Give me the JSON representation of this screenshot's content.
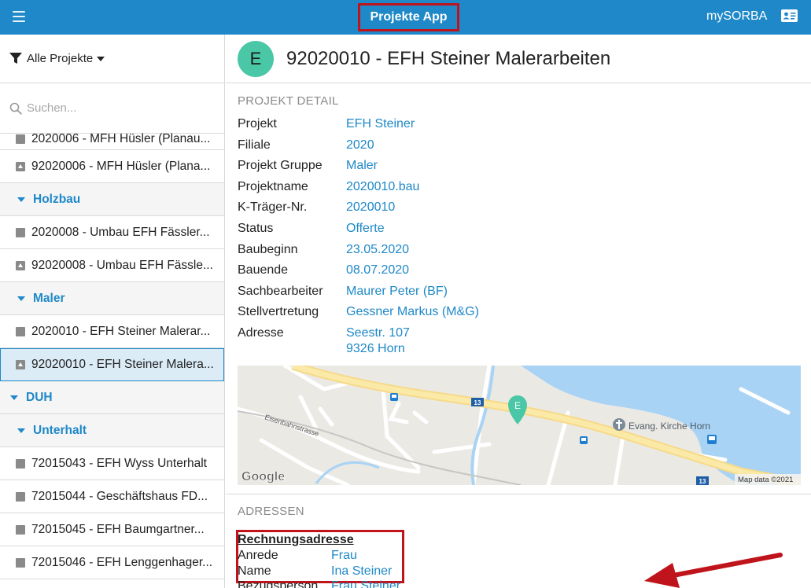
{
  "topbar": {
    "title": "Projekte App",
    "user_link": "mySORBA",
    "menu_icon": "hamburger-icon",
    "profile_icon": "id-card-icon",
    "color": "#1e88c8"
  },
  "sidebar": {
    "filter_label": "Alle Projekte",
    "search_placeholder": "Suchen...",
    "items": [
      {
        "type": "item",
        "icon": "square",
        "label": "2020006 - MFH Hüsler (Planau..."
      },
      {
        "type": "item",
        "icon": "square-tri",
        "label": "92020006 - MFH Hüsler (Plana..."
      },
      {
        "type": "group",
        "level": 1,
        "label": "Holzbau"
      },
      {
        "type": "item",
        "icon": "square",
        "label": "2020008 - Umbau EFH Fässler..."
      },
      {
        "type": "item",
        "icon": "square-tri",
        "label": "92020008 - Umbau EFH Fässle..."
      },
      {
        "type": "group",
        "level": 1,
        "label": "Maler"
      },
      {
        "type": "item",
        "icon": "square",
        "label": "2020010 - EFH Steiner Malerar..."
      },
      {
        "type": "item",
        "icon": "square-tri",
        "label": "92020010 - EFH Steiner Malera...",
        "selected": true
      },
      {
        "type": "group",
        "level": 0,
        "label": "DUH"
      },
      {
        "type": "group",
        "level": 1,
        "label": "Unterhalt"
      },
      {
        "type": "item",
        "icon": "square",
        "label": "72015043 - EFH Wyss Unterhalt"
      },
      {
        "type": "item",
        "icon": "square",
        "label": "72015044 - Geschäftshaus FD..."
      },
      {
        "type": "item",
        "icon": "square",
        "label": "72015045 - EFH Baumgartner..."
      },
      {
        "type": "item",
        "icon": "square",
        "label": "72015046 - EFH Lenggenhager..."
      }
    ]
  },
  "detail": {
    "avatar_letter": "E",
    "title": "92020010 - EFH Steiner Malerarbeiten",
    "section_title": "PROJEKT DETAIL",
    "fields": [
      {
        "label": "Projekt",
        "value": "EFH Steiner"
      },
      {
        "label": "Filiale",
        "value": "2020"
      },
      {
        "label": "Projekt Gruppe",
        "value": "Maler"
      },
      {
        "label": "Projektname",
        "value": "2020010.bau"
      },
      {
        "label": "K-Träger-Nr.",
        "value": "2020010"
      },
      {
        "label": "Status",
        "value": "Offerte"
      },
      {
        "label": "Baubeginn",
        "value": "23.05.2020"
      },
      {
        "label": "Bauende",
        "value": "08.07.2020"
      },
      {
        "label": "Sachbearbeiter",
        "value": "Maurer Peter (BF)"
      },
      {
        "label": "Stellvertretung",
        "value": "Gessner Markus (M&G)"
      },
      {
        "label": "Adresse",
        "value": "Seestr. 107",
        "value2": "9326 Horn"
      }
    ],
    "map": {
      "street_label": "Eisenbahnstrasse",
      "poi_label": "Evang. Kirche Horn",
      "road_number": "13",
      "marker_letter": "E",
      "logo": "Google",
      "attribution": "Map data ©2021"
    }
  },
  "adressen": {
    "section_title": "ADRESSEN",
    "heading": "Rechnungsadresse",
    "rows": [
      {
        "label": "Anrede",
        "value": "Frau"
      },
      {
        "label": "Name",
        "value": "Ina Steiner"
      },
      {
        "label": "Bezugsperson",
        "value": "Frau Steiner"
      }
    ]
  },
  "annotation_color": "#c0141c"
}
